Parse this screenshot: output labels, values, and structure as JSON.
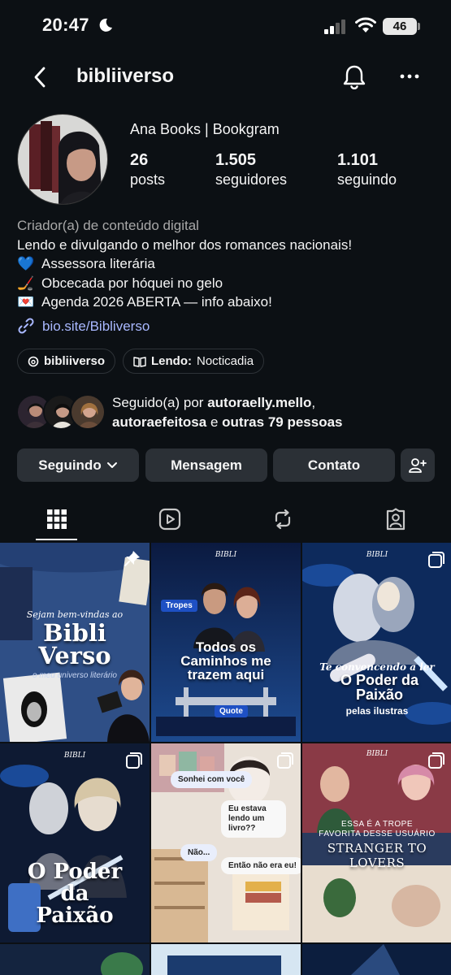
{
  "status": {
    "time": "20:47",
    "battery": "46"
  },
  "nav": {
    "username": "bibliiverso"
  },
  "profile": {
    "name": "Ana Books | Bookgram",
    "stats": [
      {
        "value": "26",
        "label": "posts"
      },
      {
        "value": "1.505",
        "label": "seguidores"
      },
      {
        "value": "1.101",
        "label": "seguindo"
      }
    ]
  },
  "bio": {
    "category": "Criador(a) de conteúdo digital",
    "lines": [
      {
        "emoji": "",
        "text": "Lendo e divulgando o melhor dos romances nacionais!"
      },
      {
        "emoji": "💙",
        "text": "Assessora literária"
      },
      {
        "emoji": "🏒",
        "text": "Obcecada por hóquei no gelo"
      },
      {
        "emoji": "💌",
        "text": "Agenda 2026 ABERTA — info abaixo!"
      }
    ],
    "link": "bio.site/Bibliverso"
  },
  "chips": {
    "threads": "bibliiverso",
    "reading_label": "Lendo:",
    "reading_title": "Nocticadia"
  },
  "followed_by": {
    "prefix": "Seguido(a) por",
    "user1": "autoraelly.mello",
    "sep": ",",
    "user2": "autoraefeitosa",
    "mid": "e",
    "rest": "outras 79 pessoas"
  },
  "buttons": {
    "following": "Seguindo",
    "message": "Mensagem",
    "contact": "Contato"
  },
  "posts": {
    "p1": {
      "title1": "Bibli",
      "title2": "Verso",
      "welcome": "Sejam bem-vindas ao",
      "sub": "o meu universo literário"
    },
    "p2": {
      "tag1": "Tropes",
      "title": "Todos os Caminhos me trazem aqui",
      "tag2": "Quote",
      "logo": "BIBLI"
    },
    "p3": {
      "line1": "Te convencendo a ler",
      "line2": "O Poder da Paixão",
      "line3": "pelas ilustras",
      "logo": "BIBLI"
    },
    "p4": {
      "title": "O Poder da Paixão",
      "logo": "BIBLI"
    },
    "p5": {
      "b1": "Sonhei com você",
      "b2": "Eu estava lendo um livro??",
      "b3": "Não...",
      "b4": "Então não era eu!"
    },
    "p6": {
      "line1": "ESSA É A TROPE",
      "line2": "FAVORITA DESSE USUÁRIO",
      "title": "STRANGER TO LOVERS",
      "logo": "BIBLI"
    }
  },
  "colors": {
    "background": "#0c1014",
    "button": "#2b3036",
    "link": "#a9b8ff",
    "secondary_text": "#a8a8a8"
  }
}
